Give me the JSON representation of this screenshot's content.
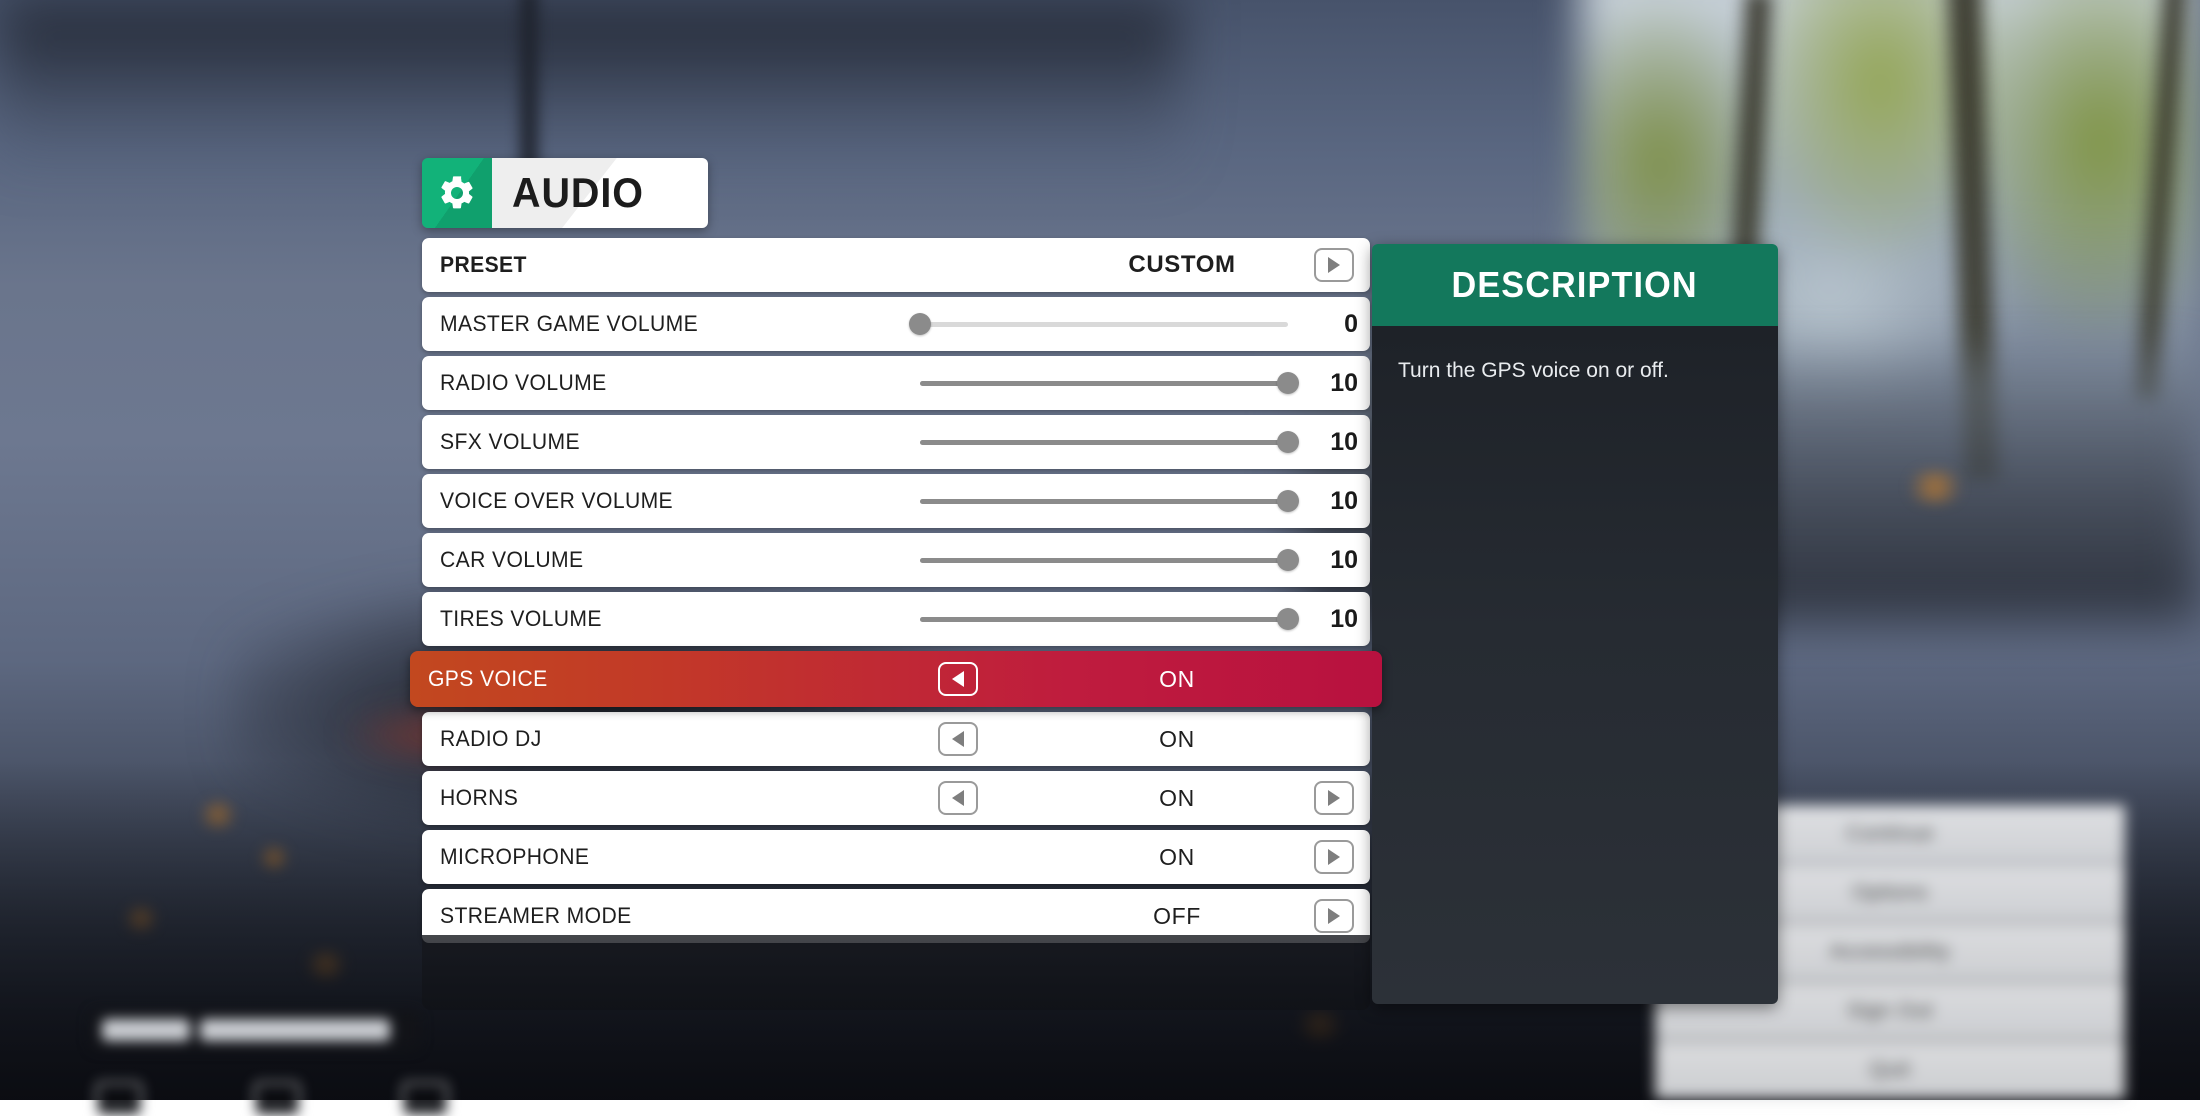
{
  "header": {
    "icon": "gear-icon",
    "title": "AUDIO",
    "accent_color": "#12b279"
  },
  "description": {
    "title": "DESCRIPTION",
    "text": "Turn the GPS voice on or off.",
    "header_color": "#13785c"
  },
  "selection": {
    "highlight_color_left": "#c2481f",
    "highlight_color_right": "#b8113f"
  },
  "rows": [
    {
      "label": "PRESET",
      "type": "enum",
      "value": "CUSTOM",
      "left_arrow": false,
      "right_arrow": true,
      "selected": false
    },
    {
      "label": "MASTER GAME VOLUME",
      "type": "slider",
      "value": "0",
      "percent": 0,
      "min": 0,
      "max": 10,
      "selected": false
    },
    {
      "label": "RADIO VOLUME",
      "type": "slider",
      "value": "10",
      "percent": 100,
      "min": 0,
      "max": 10,
      "selected": false
    },
    {
      "label": "SFX VOLUME",
      "type": "slider",
      "value": "10",
      "percent": 100,
      "min": 0,
      "max": 10,
      "selected": false
    },
    {
      "label": "VOICE OVER VOLUME",
      "type": "slider",
      "value": "10",
      "percent": 100,
      "min": 0,
      "max": 10,
      "selected": false
    },
    {
      "label": "CAR VOLUME",
      "type": "slider",
      "value": "10",
      "percent": 100,
      "min": 0,
      "max": 10,
      "selected": false
    },
    {
      "label": "TIRES VOLUME",
      "type": "slider",
      "value": "10",
      "percent": 100,
      "min": 0,
      "max": 10,
      "selected": false
    },
    {
      "label": "GPS VOICE",
      "type": "toggle",
      "value": "ON",
      "left_arrow": true,
      "right_arrow": false,
      "selected": true
    },
    {
      "label": "RADIO DJ",
      "type": "toggle",
      "value": "ON",
      "left_arrow": true,
      "right_arrow": false,
      "selected": false
    },
    {
      "label": "HORNS",
      "type": "toggle",
      "value": "ON",
      "left_arrow": true,
      "right_arrow": true,
      "selected": false
    },
    {
      "label": "MICROPHONE",
      "type": "toggle",
      "value": "ON",
      "left_arrow": false,
      "right_arrow": true,
      "selected": false
    },
    {
      "label": "STREAMER MODE",
      "type": "toggle",
      "value": "OFF",
      "left_arrow": false,
      "right_arrow": true,
      "selected": false
    }
  ],
  "background_menu": {
    "items": [
      {
        "label": "Continue"
      },
      {
        "label": "Options"
      },
      {
        "label": "Accessibility"
      },
      {
        "label": "Sign Out"
      },
      {
        "label": "Quit"
      }
    ]
  }
}
